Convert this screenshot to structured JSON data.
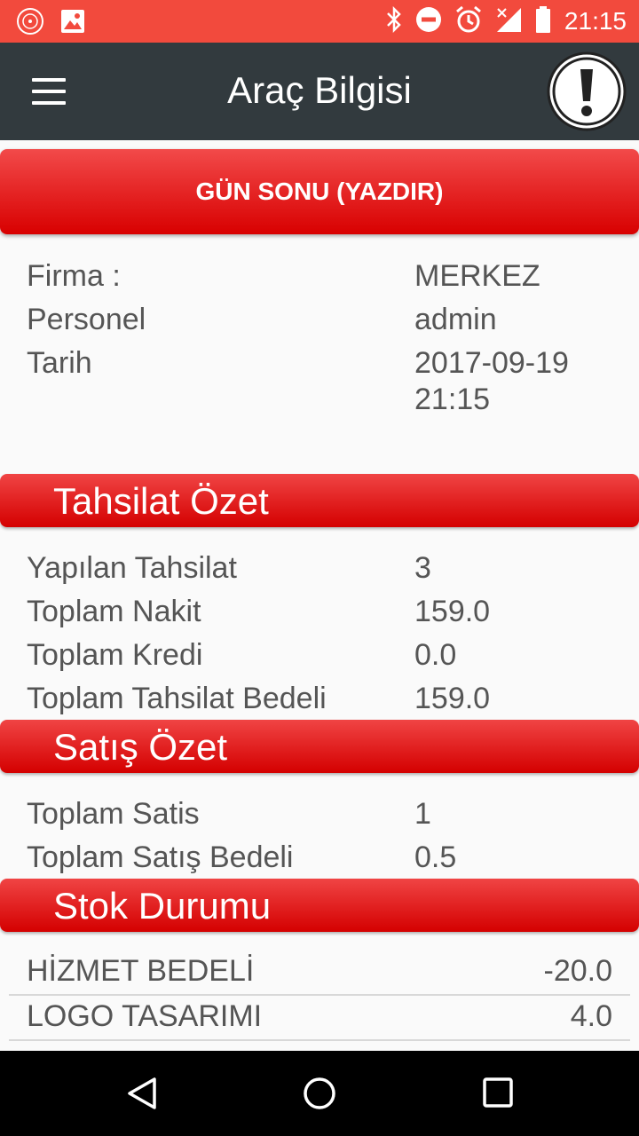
{
  "status_bar": {
    "time": "21:15",
    "icons": [
      "app-logo-icon",
      "image-icon",
      "bluetooth-icon",
      "do-not-disturb-icon",
      "alarm-icon",
      "signal-icon",
      "battery-icon"
    ]
  },
  "app_bar": {
    "title": "Araç Bilgisi"
  },
  "print_button": {
    "label": "GÜN SONU (YAZDIR)"
  },
  "info": {
    "firma_label": "Firma :",
    "firma_value": "MERKEZ",
    "personel_label": "Personel",
    "personel_value": "admin",
    "tarih_label": "Tarih",
    "tarih_date": "2017-09-19",
    "tarih_time": "21:15"
  },
  "tahsilat": {
    "header": "Tahsilat Özet",
    "rows": [
      {
        "label": "Yapılan Tahsilat",
        "value": "3"
      },
      {
        "label": "Toplam Nakit",
        "value": "159.0"
      },
      {
        "label": "Toplam Kredi",
        "value": "0.0"
      },
      {
        "label": "Toplam Tahsilat Bedeli",
        "value": "159.0"
      }
    ]
  },
  "satis": {
    "header": "Satış Özet",
    "rows": [
      {
        "label": "Toplam Satis",
        "value": "1"
      },
      {
        "label": "Toplam Satış Bedeli",
        "value": "0.5"
      }
    ]
  },
  "stok": {
    "header": "Stok Durumu",
    "rows": [
      {
        "label": "HİZMET BEDELİ",
        "value": "-20.0"
      },
      {
        "label": "LOGO TASARIMI",
        "value": "4.0"
      }
    ]
  },
  "colors": {
    "accent_red": "#d80000",
    "status_bar": "#f24a3d",
    "app_bar": "#323a3e"
  }
}
